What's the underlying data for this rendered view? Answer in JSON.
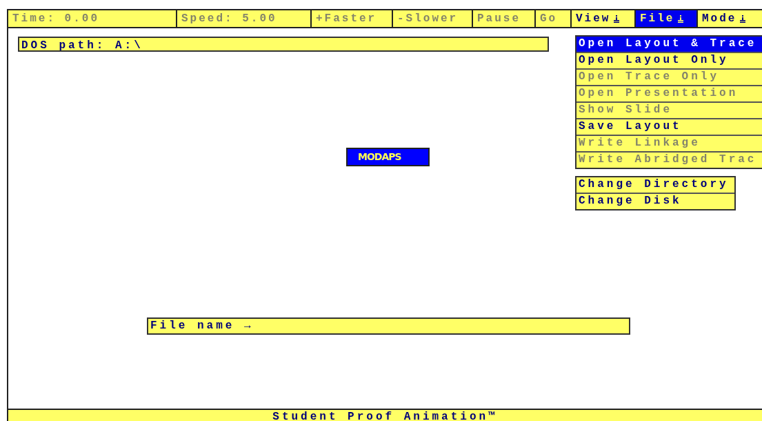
{
  "toolbar": [
    {
      "label": "Time: 0.00",
      "kind": "readout",
      "disabled": true,
      "selected": false
    },
    {
      "label": "Speed: 5.00",
      "kind": "readout",
      "disabled": true,
      "selected": false
    },
    {
      "label": "+Faster",
      "kind": "button",
      "disabled": true,
      "selected": false
    },
    {
      "label": "-Slower",
      "kind": "button",
      "disabled": true,
      "selected": false
    },
    {
      "label": "Pause",
      "kind": "button",
      "disabled": true,
      "selected": false
    },
    {
      "label": "Go",
      "kind": "button",
      "disabled": true,
      "selected": false
    },
    {
      "label": "View",
      "kind": "menu",
      "disabled": false,
      "selected": false
    },
    {
      "label": "File",
      "kind": "menu",
      "disabled": false,
      "selected": true
    },
    {
      "label": "Mode",
      "kind": "menu",
      "disabled": false,
      "selected": false
    }
  ],
  "dos_path": {
    "label": "DOS path: A:\\"
  },
  "project_label": "MODAPS",
  "file_menu": {
    "groups": [
      [
        {
          "label": "Open Layout & Trace",
          "disabled": false,
          "selected": true
        },
        {
          "label": "Open Layout Only",
          "disabled": false,
          "selected": false
        },
        {
          "label": "Open Trace Only",
          "disabled": true,
          "selected": false
        },
        {
          "label": "Open Presentation",
          "disabled": true,
          "selected": false
        },
        {
          "label": "Show Slide",
          "disabled": true,
          "selected": false
        },
        {
          "label": "Save Layout",
          "disabled": false,
          "selected": false
        },
        {
          "label": "Write Linkage",
          "disabled": true,
          "selected": false
        },
        {
          "label": "Write Abridged Trac",
          "disabled": true,
          "selected": false
        }
      ],
      [
        {
          "label": "Change Directory",
          "disabled": false,
          "selected": false
        },
        {
          "label": "Change Disk",
          "disabled": false,
          "selected": false
        }
      ]
    ]
  },
  "file_name": {
    "label": "File name →"
  },
  "status_bar": "Student Proof Animation™"
}
